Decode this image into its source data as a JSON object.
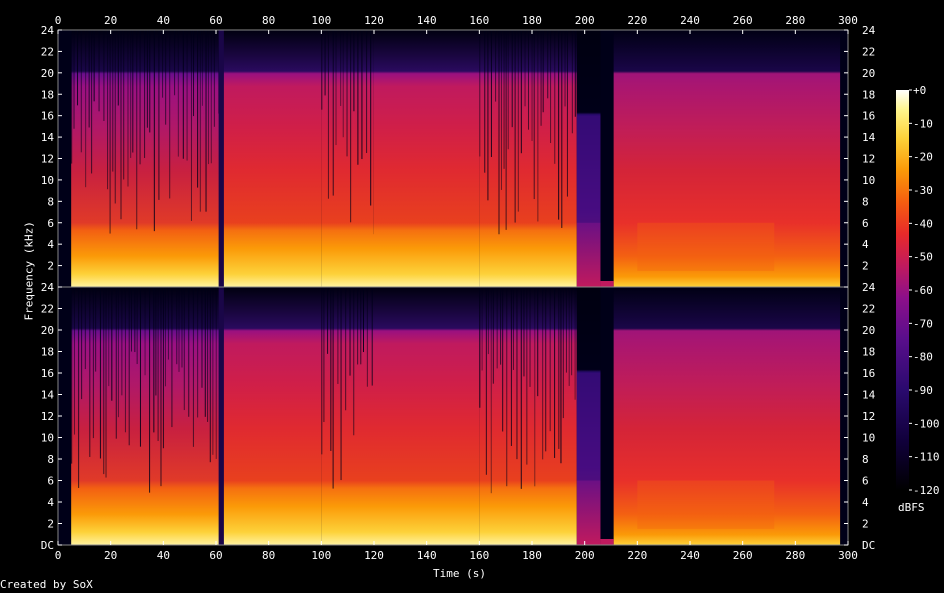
{
  "chart_data": {
    "type": "heatmap",
    "title": "",
    "xlabel": "Time (s)",
    "ylabel": "Frequency (kHz)",
    "credit": "Created by SoX",
    "xlim": [
      0,
      300
    ],
    "ylim_khz": [
      0,
      24
    ],
    "x_ticks": [
      "0",
      "20",
      "40",
      "60",
      "80",
      "100",
      "120",
      "140",
      "160",
      "180",
      "200",
      "220",
      "240",
      "260",
      "280",
      "300"
    ],
    "y_ticks_top": [
      "24",
      "22",
      "20",
      "18",
      "16",
      "14",
      "12",
      "10",
      "8",
      "6",
      "4",
      "2"
    ],
    "y_ticks_bottom": [
      "24",
      "22",
      "20",
      "18",
      "16",
      "14",
      "12",
      "10",
      "8",
      "6",
      "4",
      "2",
      "DC"
    ],
    "channels": 2,
    "colorbar": {
      "unit": "dBFS",
      "range": [
        -120,
        0
      ],
      "ticks": [
        "+0",
        "-10",
        "-20",
        "-30",
        "-40",
        "-50",
        "-60",
        "-70",
        "-80",
        "-90",
        "-100",
        "-110",
        "-120"
      ]
    },
    "segments": [
      {
        "start": 0,
        "end": 5,
        "level": "near-silence"
      },
      {
        "start": 5,
        "end": 62,
        "cutoff_khz": 20,
        "level": "loud, sparse high-frequency streaks"
      },
      {
        "start": 62,
        "end": 100,
        "cutoff_khz": 20,
        "level": "loud, dense"
      },
      {
        "start": 100,
        "end": 120,
        "cutoff_khz": 20,
        "level": "loud, streaks"
      },
      {
        "start": 120,
        "end": 160,
        "cutoff_khz": 20,
        "level": "loud, dense"
      },
      {
        "start": 160,
        "end": 197,
        "cutoff_khz": 20,
        "level": "loud, streaks"
      },
      {
        "start": 197,
        "end": 210,
        "cutoff_khz": 16,
        "level": "fade out"
      },
      {
        "start": 210,
        "end": 297,
        "cutoff_khz": 20,
        "level": "moderate, steady"
      },
      {
        "start": 297,
        "end": 300,
        "level": "near-silence"
      }
    ],
    "colors": {
      "background": "#000000",
      "axis": "#ffffff",
      "silence": "#000018",
      "scale": [
        "#000000",
        "#10003a",
        "#2a0a6e",
        "#5a0e8c",
        "#8c0f8a",
        "#c01a5e",
        "#e82a2a",
        "#f55e10",
        "#fb9a08",
        "#fdd23a",
        "#fef58c",
        "#ffffff"
      ]
    }
  }
}
